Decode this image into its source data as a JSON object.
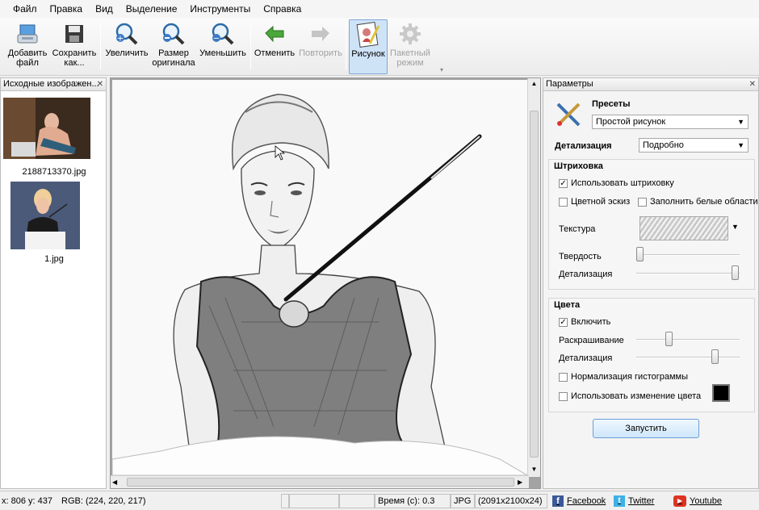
{
  "menu": [
    "Файл",
    "Правка",
    "Вид",
    "Выделение",
    "Инструменты",
    "Справка"
  ],
  "toolbar": {
    "add_file": "Добавить файл",
    "save_as": "Сохранить как...",
    "zoom_in": "Увеличить",
    "original_size": "Размер оригинала",
    "zoom_out": "Уменьшить",
    "undo": "Отменить",
    "redo": "Повторить",
    "drawing": "Рисунок",
    "batch": "Пакетный режим"
  },
  "left_pane": {
    "title": "Исходные изображен...",
    "files": [
      {
        "name": "2188713370.jpg"
      },
      {
        "name": "1.jpg"
      }
    ]
  },
  "params": {
    "title": "Параметры",
    "presets_label": "Пресеты",
    "preset_value": "Простой рисунок",
    "detail_label": "Детализация",
    "detail_value": "Подробно",
    "hatching": {
      "title": "Штриховка",
      "use_hatching": "Использовать штриховку",
      "use_hatching_checked": true,
      "color_sketch": "Цветной эскиз",
      "color_sketch_checked": false,
      "fill_white": "Заполнить белые области",
      "fill_white_checked": false,
      "texture": "Текстура",
      "hardness": "Твердость",
      "hardness_value": 0.0,
      "detail": "Детализация",
      "detail_value": 1.0
    },
    "colors": {
      "title": "Цвета",
      "enable": "Включить",
      "enable_checked": true,
      "coloring": "Раскрашивание",
      "coloring_value": 0.3,
      "detail": "Детализация",
      "detail_value": 0.75,
      "normalize": "Нормализация гистограммы",
      "normalize_checked": false,
      "change_color": "Использовать изменение цвета",
      "change_color_checked": false,
      "swatch_color": "#000000"
    },
    "run": "Запустить"
  },
  "status": {
    "coords": "x: 806 y: 437",
    "rgb": "RGB: (224, 220, 217)",
    "time": "Время (с): 0.3",
    "format": "JPG",
    "dims": "(2091x2100x24)",
    "facebook": "Facebook",
    "twitter": "Twitter",
    "youtube": "Youtube"
  }
}
